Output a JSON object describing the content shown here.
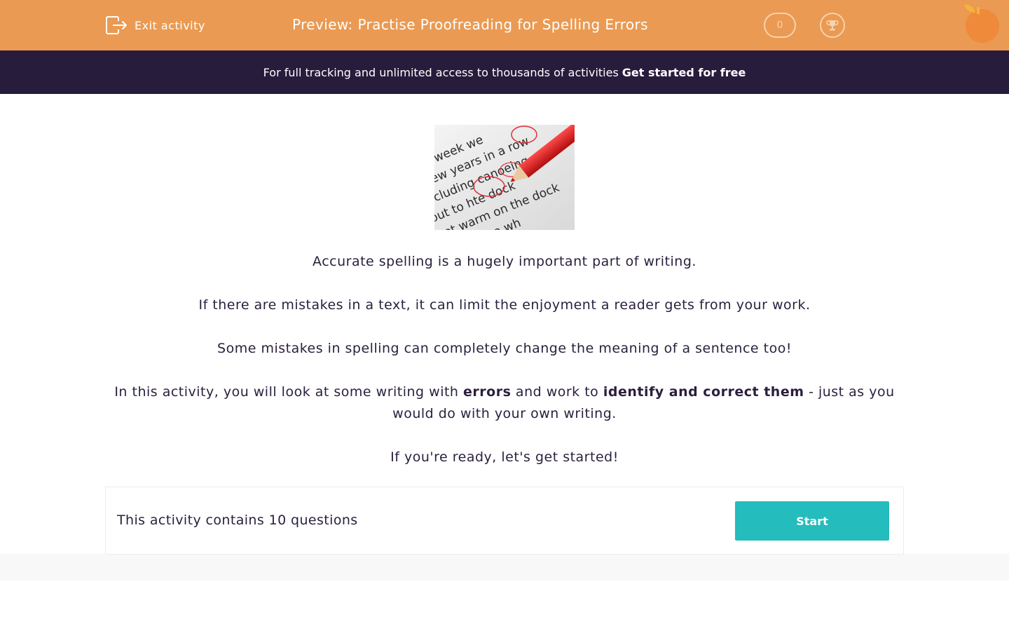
{
  "header": {
    "exit_label": "Exit activity",
    "title": "Preview: Practise Proofreading for Spelling Errors",
    "score": "0",
    "brand_color": "#ea9a52"
  },
  "banner": {
    "text": "For full tracking and unlimited access to thousands of activities",
    "link": "Get started for free"
  },
  "image": {
    "lines": [
      "one week we",
      "a few years in a row",
      "including canoeing",
      "out to hte dock",
      "get warm on the dock",
      "splash me wh"
    ]
  },
  "intro": {
    "p1": "Accurate spelling is a hugely important part of writing.",
    "p2": "If there are mistakes in a text, it can limit the enjoyment a reader gets from your work.",
    "p3": "Some mistakes in spelling can completely change the meaning of a sentence too!",
    "p4_a": "In this activity, you will look at some writing with",
    "p4_b": "errors",
    "p4_c": "and work to",
    "p4_d": "identify and correct them",
    "p4_e": "- just as you would do with your own writing.",
    "p5": "If you're ready, let's get started!"
  },
  "card": {
    "text": "This activity contains 10 questions",
    "start_label": "Start",
    "button_color": "#24bcbd"
  }
}
